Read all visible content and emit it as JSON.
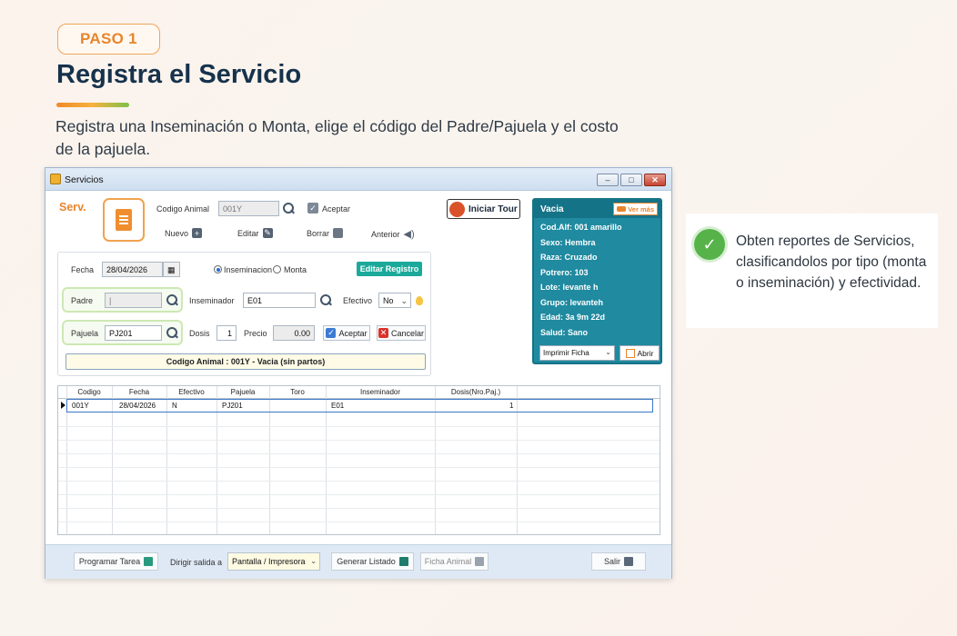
{
  "header": {
    "step": "PASO 1",
    "title": "Registra el Servicio",
    "description": "Registra una Inseminación o Monta, elige el código del Padre/Pajuela y el costo de la pajuela."
  },
  "window": {
    "title": "Servicios",
    "serv_label": "Serv.",
    "codigo_animal_label": "Codigo Animal",
    "codigo_animal_value": "001Y",
    "aceptar_label": "Aceptar",
    "toolbar": {
      "nuevo": "Nuevo",
      "editar": "Editar",
      "borrar": "Borrar",
      "anterior": "Anterior"
    },
    "tour_button": "Iniciar Tour",
    "form": {
      "fecha_label": "Fecha",
      "fecha_value": "28/04/2026",
      "radio_inseminacion": "Inseminacion",
      "radio_monta": "Monta",
      "editar_registro": "Editar Registro",
      "padre_label": "Padre",
      "padre_value": "|",
      "inseminador_label": "Inseminador",
      "inseminador_value": "E01",
      "efectivo_label": "Efectivo",
      "efectivo_value": "No",
      "pajuela_label": "Pajuela",
      "pajuela_value": "PJ201",
      "dosis_label": "Dosis",
      "dosis_value": "1",
      "precio_label": "Precio",
      "precio_value": "0.00",
      "aceptar": "Aceptar",
      "cancelar": "Cancelar",
      "summary": "Codigo Animal : 001Y - Vacia (sin partos)"
    },
    "info_panel": {
      "status": "Vacia",
      "ver_mas": "Ver más",
      "lines": [
        "Cod.Alf: 001 amarillo",
        "Sexo: Hembra",
        "Raza: Cruzado",
        "Potrero: 103",
        "Lote: levante h",
        "Grupo: levanteh",
        "Edad: 3a 9m 22d",
        "Salud: Sano"
      ],
      "print_select": "Imprimir Ficha",
      "abrir": "Abrir"
    },
    "grid": {
      "columns": [
        "Codigo",
        "Fecha",
        "Efectivo",
        "Pajuela",
        "Toro",
        "Inseminador",
        "Dosis(Nro.Paj.)"
      ],
      "rows": [
        [
          "001Y",
          "28/04/2026",
          "N",
          "PJ201",
          "",
          "E01",
          "1"
        ]
      ]
    },
    "bottom": {
      "programar_tarea": "Programar Tarea",
      "dirigir_label": "Dirigir salida a",
      "salida_value": "Pantalla / Impresora",
      "generar_listado": "Generar Listado",
      "ficha_animal": "Ficha Animal",
      "salir": "Salir"
    }
  },
  "side_card": {
    "text": "Obten reportes de Servicios, clasificandolos por tipo (monta o inseminación) y efectividad."
  },
  "colors": {
    "accent_orange": "#e8852c",
    "title_navy": "#16324c",
    "teal": "#1f8aa0",
    "check_green": "#56b34a"
  }
}
